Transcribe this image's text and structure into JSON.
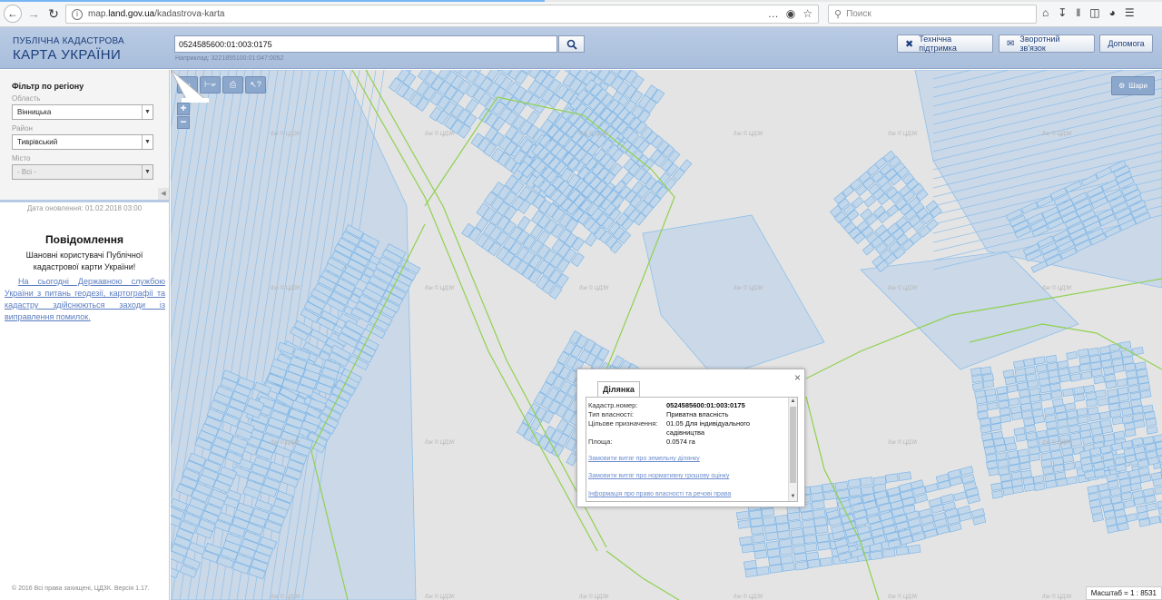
{
  "browser": {
    "url_prefix": "map.",
    "url_host": "land.gov.ua",
    "url_path": "/kadastrova-karta",
    "search_placeholder": "Поиск",
    "more_icon": "…"
  },
  "header": {
    "title_line1": "ПУБЛІЧНА КАДАСТРОВА",
    "title_line2": "КАРТА УКРАЇНИ",
    "search_value": "0524585600:01:003:0175",
    "search_hint": "Наприклад: 3221855100:01:047:0052",
    "support_label": "Технічна підтримка",
    "feedback_label": "Зворотний зв'язок",
    "help_label": "Допомога"
  },
  "sidebar": {
    "filter_title": "Фільтр по регіону",
    "region_label": "Область",
    "region_value": "Вінницька",
    "district_label": "Район",
    "district_value": "Тиврівський",
    "city_label": "Місто",
    "city_value": "- Всі -",
    "update_date": "Дата оновлення: 01.02.2018 03:00",
    "notice_title": "Повідомлення",
    "notice_greeting": "Шановні користувачі Публічної кадастрової карти України!",
    "notice_text": "На сьогодні Державною службою України з питань геодезії, картографії та кадастру здійснюються заходи із виправлення помилок.",
    "copyright": "© 2016 Всі права захищені, ЦДЗК. Версія 1.17."
  },
  "map": {
    "tools": [
      "|м",
      "⊢м²",
      "print",
      "info"
    ],
    "zoom_in": "+",
    "zoom_out": "−",
    "layers_label": "Шари",
    "scale_text": "Масштаб = 1 : 8531",
    "watermark": "дзк © ЦДЗК"
  },
  "popup": {
    "tab_label": "Ділянка",
    "close": "×",
    "fields": [
      {
        "label": "Кадастр.номер:",
        "value": "0524585600:01:003:0175"
      },
      {
        "label": "Тип власності:",
        "value": "Приватна власність"
      },
      {
        "label": "Цільове призначення:",
        "value": "01.05 Для індивідуального садівництва"
      },
      {
        "label": "Площа:",
        "value": "0.0574 га"
      }
    ],
    "links": [
      "Замовити витяг про земельну ділянку",
      "Замовити витяг про нормативну грошову оцінку",
      "Інформація про право власності та речові права"
    ]
  },
  "colors": {
    "parcel_fill": "#c3d7ea",
    "parcel_stroke": "#7fb6e6",
    "boundary": "#8fd14f",
    "header_bg": "#b9cbe4",
    "title": "#1c3e7a"
  }
}
